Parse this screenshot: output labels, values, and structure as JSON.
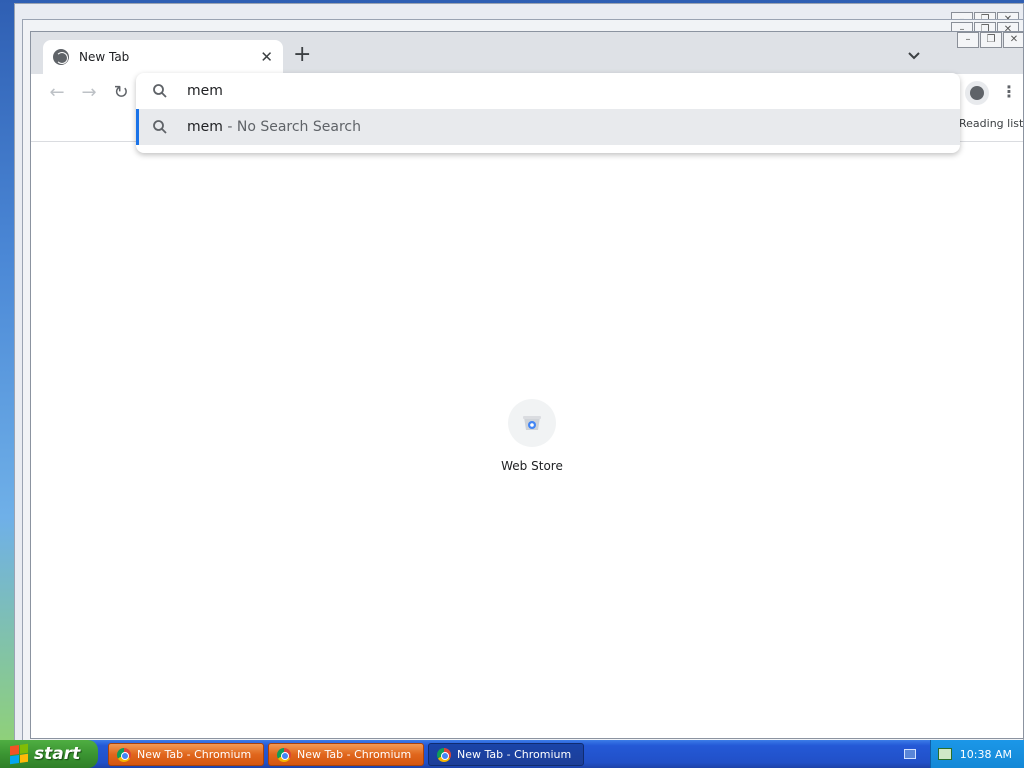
{
  "browser": {
    "tab": {
      "title": "New Tab"
    },
    "toolbar": {
      "reading_list_label": "Reading list"
    },
    "omnibox": {
      "input_value": "mem",
      "suggestion": {
        "query": "mem",
        "separator": " - ",
        "description": "No Search Search"
      }
    },
    "ntp": {
      "shortcuts": [
        {
          "label": "Web Store"
        }
      ]
    }
  },
  "taskbar": {
    "start_label": "start",
    "tasks": [
      {
        "label": "New Tab - Chromium",
        "state": "inactive"
      },
      {
        "label": "New Tab - Chromium",
        "state": "inactive"
      },
      {
        "label": "New Tab - Chromium",
        "state": "active"
      }
    ],
    "clock": "10:38 AM"
  },
  "icons": {
    "tab_favicon": "globe-icon",
    "omnibox": "search-icon",
    "shortcut": "web-store-icon",
    "taskbar_task": "chromium-icon"
  },
  "colors": {
    "accent": "#1a73e8",
    "tabstrip": "#dee1e6",
    "suggestion_highlight": "#e8eaed",
    "taskbar": "#2150c8",
    "start_button": "#3b9532",
    "task_inactive": "#e0661c"
  }
}
